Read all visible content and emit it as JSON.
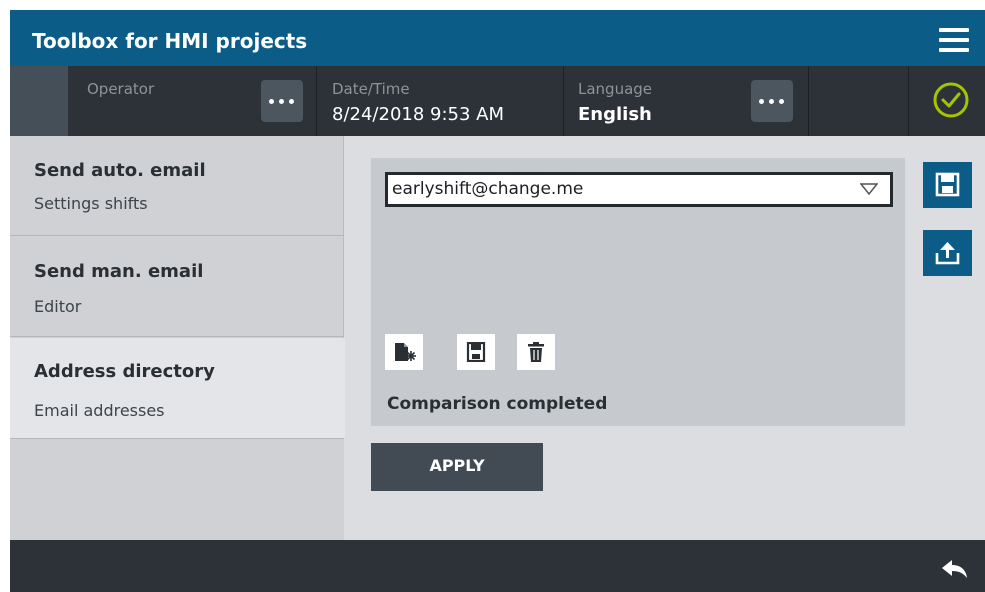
{
  "app": {
    "title": "Toolbox for HMI projects"
  },
  "statusbar": {
    "operator_label": "Operator",
    "datetime_label": "Date/Time",
    "datetime_value": "8/24/2018 9:53 AM",
    "language_label": "Language",
    "language_value": "English"
  },
  "sidebar": {
    "items": [
      {
        "title": "Send auto. email",
        "subtitle": "Settings shifts",
        "active": false
      },
      {
        "title": "Send man. email",
        "subtitle": "Editor",
        "active": false
      },
      {
        "title": "Address directory",
        "subtitle": "Email addresses",
        "active": true
      }
    ]
  },
  "main": {
    "email_select": {
      "value": "earlyshift@change.me"
    },
    "status_text": "Comparison completed",
    "apply_label": "APPLY"
  },
  "icons": {
    "menu": "hamburger-menu-icon",
    "dots": "more-options-icon",
    "ok": "check-circle-icon",
    "dropdown": "chevron-down-icon",
    "new": "new-entry-icon",
    "save": "save-icon",
    "delete": "trash-icon",
    "upload": "upload-icon",
    "back": "back-arrow-icon"
  },
  "colors": {
    "header_blue": "#0b5c87",
    "dark_bar": "#2c3238",
    "ok_green": "#a7c400"
  }
}
